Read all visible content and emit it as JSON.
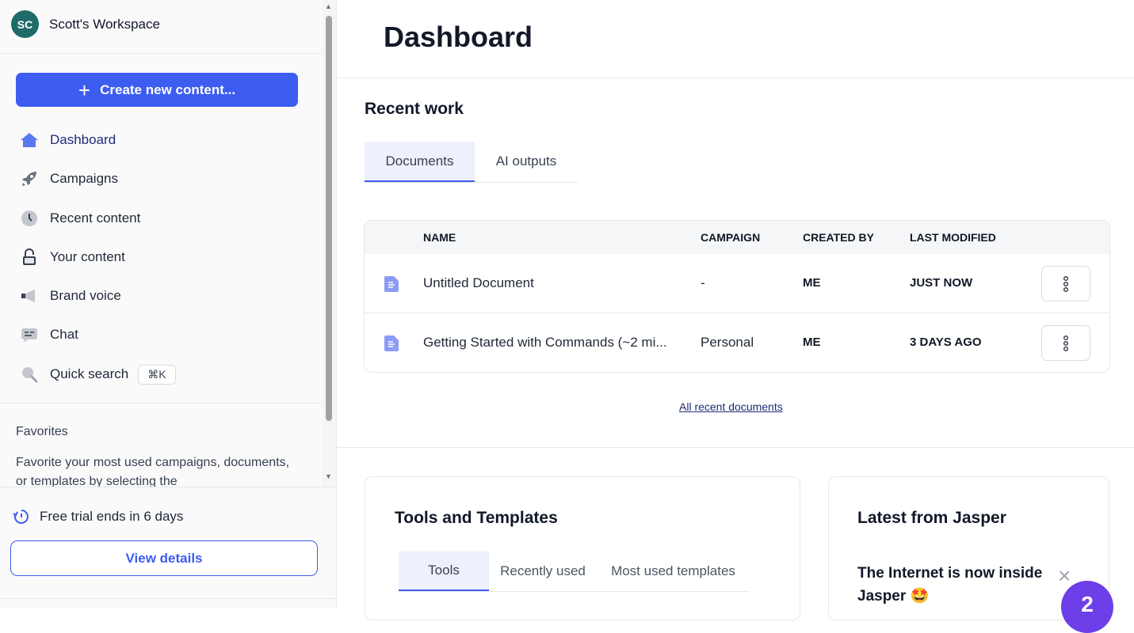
{
  "sidebar": {
    "workspace": {
      "initials": "SC",
      "name": "Scott's Workspace"
    },
    "create_button": {
      "icon": "plus-icon",
      "label": "Create new content..."
    },
    "nav": [
      {
        "label": "Dashboard",
        "icon": "home-icon",
        "active": true
      },
      {
        "label": "Campaigns",
        "icon": "rocket-icon"
      },
      {
        "label": "Recent content",
        "icon": "clock-icon"
      },
      {
        "label": "Your content",
        "icon": "lock-icon"
      },
      {
        "label": "Brand voice",
        "icon": "megaphone-icon"
      },
      {
        "label": "Chat",
        "icon": "chat-icon"
      },
      {
        "label": "Quick search",
        "icon": "search-icon",
        "shortcut": "⌘K"
      }
    ],
    "favorites": {
      "title": "Favorites",
      "text": "Favorite your most used campaigns, documents, or templates by selecting the"
    },
    "trial": {
      "icon": "timer-icon",
      "text": "Free trial ends in 6 days",
      "button": "View details"
    }
  },
  "main": {
    "title": "Dashboard",
    "recent_work": {
      "title": "Recent work",
      "tabs": [
        {
          "label": "Documents",
          "active": true
        },
        {
          "label": "AI outputs"
        }
      ],
      "table": {
        "columns": [
          "NAME",
          "CAMPAIGN",
          "CREATED BY",
          "LAST MODIFIED"
        ],
        "rows": [
          {
            "name": "Untitled Document",
            "campaign": "-",
            "created_by": "ME",
            "last_modified": "JUST NOW"
          },
          {
            "name": "Getting Started with Commands (~2 mi...",
            "campaign": "Personal",
            "created_by": "ME",
            "last_modified": "3 DAYS AGO"
          }
        ]
      },
      "all_link": "All recent documents"
    },
    "tools": {
      "title": "Tools and Templates",
      "tabs": [
        {
          "label": "Tools",
          "active": true
        },
        {
          "label": "Recently used"
        },
        {
          "label": "Most used templates"
        }
      ]
    },
    "latest": {
      "title": "Latest from Jasper",
      "headline": "The Internet is now inside Jasper",
      "emoji": "🤩"
    },
    "help_badge": "2"
  },
  "colors": {
    "accent": "#3d5cf0",
    "active_tab_bg": "#eef0fd",
    "avatar": "#1f6b6a",
    "help_bubble": "#6d3fe8"
  }
}
